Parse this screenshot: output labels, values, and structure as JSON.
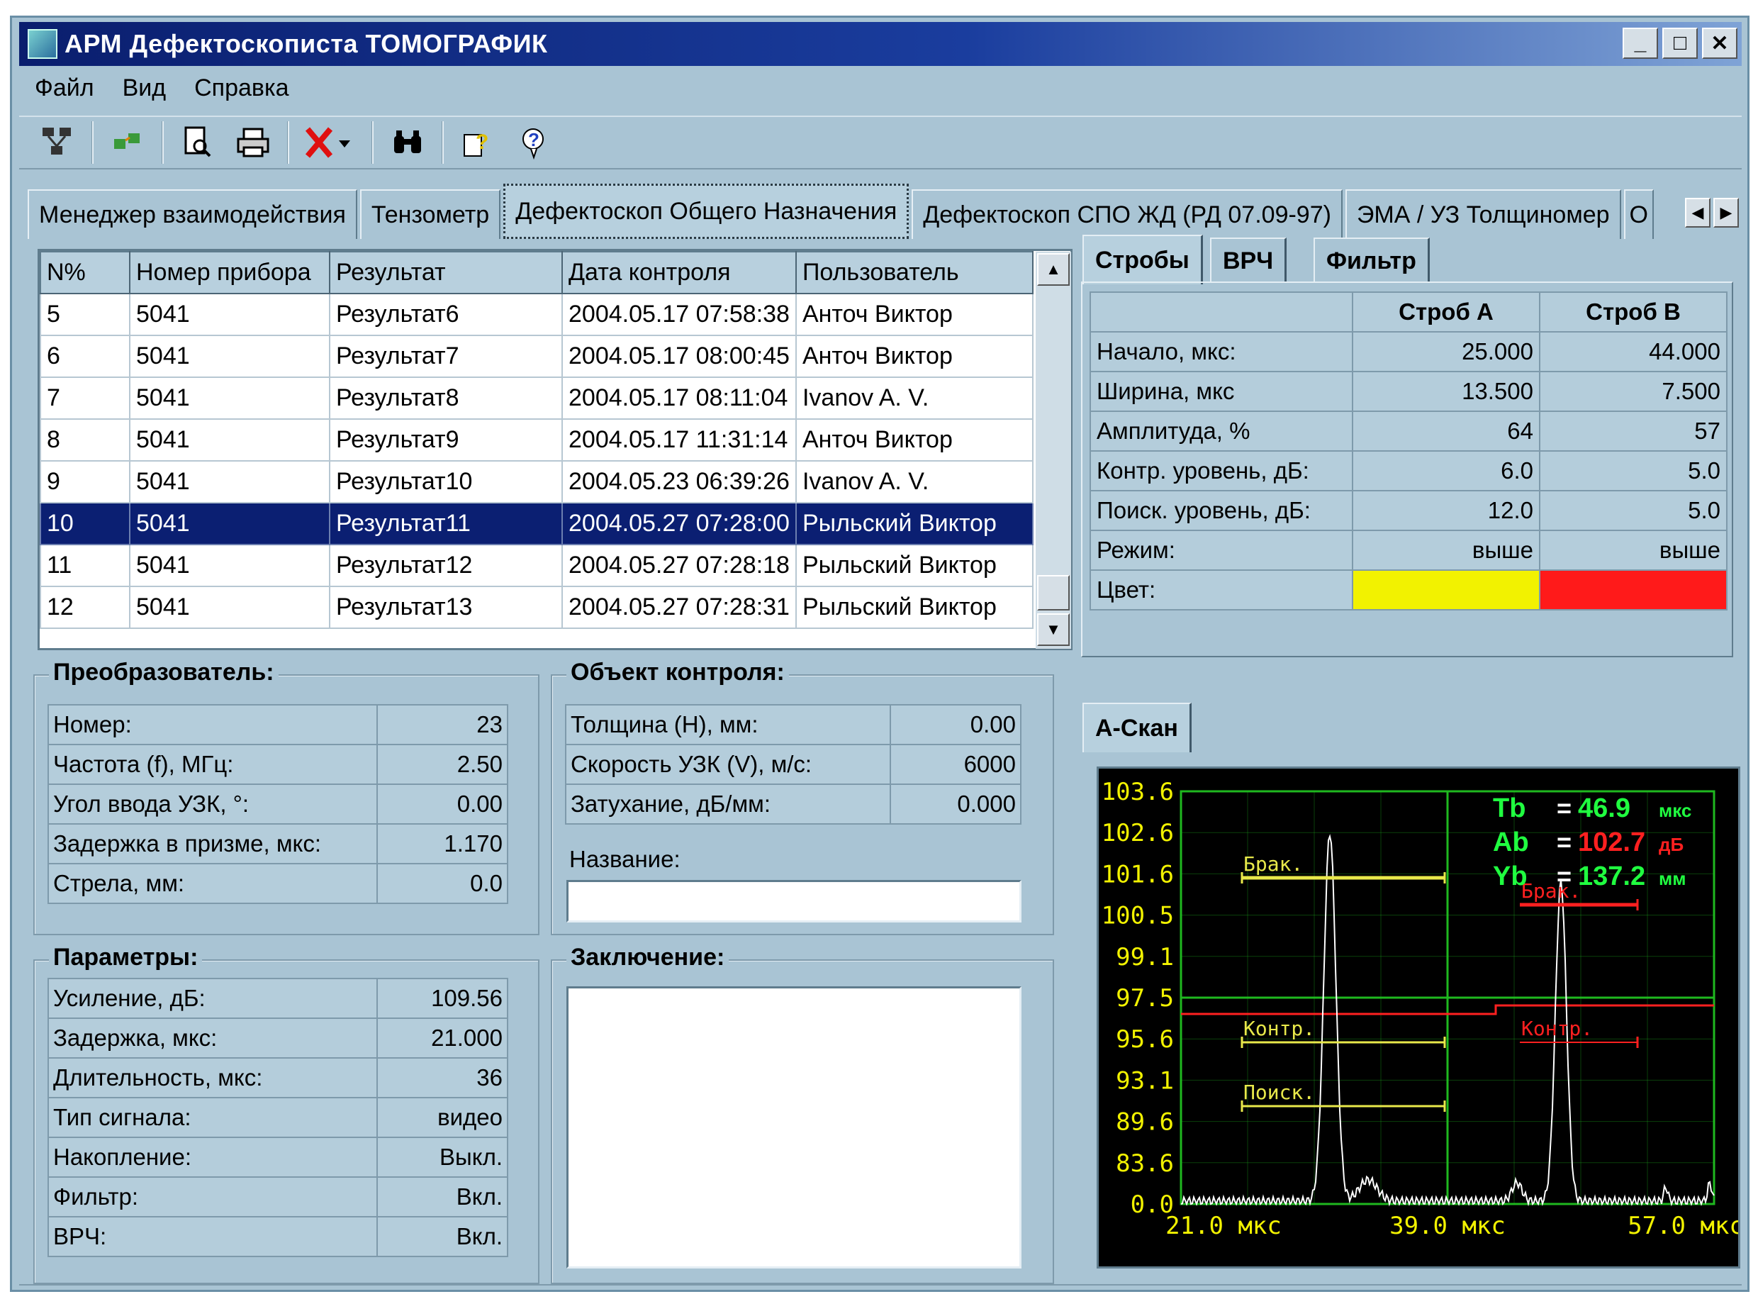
{
  "window": {
    "title": "АРМ Дефектоскописта ТОМОГРАФИК",
    "buttons": [
      "_",
      "□",
      "✕"
    ]
  },
  "menu": [
    "Файл",
    "Вид",
    "Справка"
  ],
  "toolbar_icons": [
    "network-icon",
    "refresh-icon",
    "print-preview-icon",
    "print-icon",
    "delete-icon",
    "binoculars-icon",
    "help-icon",
    "context-help-icon"
  ],
  "tabs": [
    {
      "label": "Менеджер взаимодействия"
    },
    {
      "label": "Тензометр"
    },
    {
      "label": "Дефектоскоп Общего Назначения",
      "active": true
    },
    {
      "label": "Дефектоскоп СПО ЖД (РД 07.09-97)"
    },
    {
      "label": "ЭМА / УЗ Толщиномер"
    },
    {
      "label": "О"
    }
  ],
  "results": {
    "columns": [
      "N%",
      "Номер прибора",
      "Результат",
      "Дата контроля",
      "Пользователь"
    ],
    "rows": [
      [
        "5",
        "5041",
        "Результат6",
        "2004.05.17 07:58:38",
        "Анточ Виктор"
      ],
      [
        "6",
        "5041",
        "Результат7",
        "2004.05.17 08:00:45",
        "Анточ Виктор"
      ],
      [
        "7",
        "5041",
        "Результат8",
        "2004.05.17 08:11:04",
        "Ivanov A. V."
      ],
      [
        "8",
        "5041",
        "Результат9",
        "2004.05.17 11:31:14",
        "Анточ Виктор"
      ],
      [
        "9",
        "5041",
        "Результат10",
        "2004.05.23 06:39:26",
        "Ivanov A. V."
      ],
      [
        "10",
        "5041",
        "Результат11",
        "2004.05.27 07:28:00",
        "Рыльский Виктор"
      ],
      [
        "11",
        "5041",
        "Результат12",
        "2004.05.27 07:28:18",
        "Рыльский Виктор"
      ],
      [
        "12",
        "5041",
        "Результат13",
        "2004.05.27 07:28:31",
        "Рыльский Виктор"
      ]
    ],
    "selected_row": 5
  },
  "transducer": {
    "title": "Преобразователь:",
    "rows": [
      [
        "Номер:",
        "23"
      ],
      [
        "Частота (f), МГц:",
        "2.50"
      ],
      [
        "Угол ввода УЗК, °:",
        "0.00"
      ],
      [
        "Задержка в призме, мкс:",
        "1.170"
      ],
      [
        "Стрела, мм:",
        "0.0"
      ]
    ]
  },
  "object": {
    "title": "Объект контроля:",
    "rows": [
      [
        "Толщина (H), мм:",
        "0.00"
      ],
      [
        "Скорость УЗК (V), м/с:",
        "6000"
      ],
      [
        "Затухание, дБ/мм:",
        "0.000"
      ]
    ],
    "name_label": "Название:",
    "name_value": ""
  },
  "parameters": {
    "title": "Параметры:",
    "rows": [
      [
        "Усиление, дБ:",
        "109.56"
      ],
      [
        "Задержка, мкс:",
        "21.000"
      ],
      [
        "Длительность, мкс:",
        "36"
      ],
      [
        "Тип сигнала:",
        "видео"
      ],
      [
        "Накопление:",
        "Выкл."
      ],
      [
        "Фильтр:",
        "Вкл."
      ],
      [
        "ВРЧ:",
        "Вкл."
      ]
    ]
  },
  "conclusion": {
    "title": "Заключение:",
    "value": ""
  },
  "strobe_tabs": [
    "Стробы",
    "ВРЧ",
    "Фильтр"
  ],
  "strobes": {
    "headers": [
      "",
      "Строб А",
      "Строб В"
    ],
    "rows": [
      [
        "Начало, мкс:",
        "25.000",
        "44.000"
      ],
      [
        "Ширина, мкс",
        "13.500",
        "7.500"
      ],
      [
        "Амплитуда, %",
        "64",
        "57"
      ],
      [
        "Контр. уровень, дБ:",
        "6.0",
        "5.0"
      ],
      [
        "Поиск. уровень, дБ:",
        "12.0",
        "5.0"
      ],
      [
        "Режим:",
        "выше",
        "выше"
      ],
      [
        "Цвет:",
        "",
        ""
      ]
    ],
    "colors": [
      "#f2f200",
      "#ff1a1a"
    ]
  },
  "ascan_tab": "А-Скан",
  "ascan": {
    "y_ticks": [
      "103.6",
      "102.6",
      "101.6",
      "100.5",
      "99.1",
      "97.5",
      "95.6",
      "93.1",
      "89.6",
      "83.6",
      "0.0"
    ],
    "x_ticks": [
      "21.0 мкс",
      "39.0 мкс",
      "57.0 мкс"
    ],
    "readouts": [
      {
        "name": "Tb",
        "eq": "=",
        "value": "46.9",
        "unit": "мкс",
        "color": "#20ff40"
      },
      {
        "name": "Ab",
        "eq": "=",
        "value": "102.7",
        "unit": "дБ",
        "color": "#ff2020"
      },
      {
        "name": "Yb",
        "eq": "=",
        "value": "137.2",
        "unit": "мм",
        "color": "#20ff40"
      }
    ],
    "gate_a_labels": [
      "Брак.",
      "Контр.",
      "Поиск."
    ],
    "gate_b_labels": [
      "Брак.",
      "Контр."
    ],
    "colors": {
      "grid": "#1fb81f",
      "signal": "#ffffff",
      "gate_a": "#e8e84a",
      "gate_b": "#ff2020",
      "text": "#f2f200"
    }
  }
}
